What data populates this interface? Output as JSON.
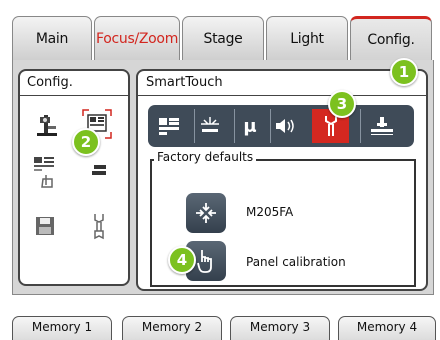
{
  "tabs": [
    {
      "label": "Main",
      "active": false,
      "color": "#111111"
    },
    {
      "label": "Focus/Zoom",
      "active": false,
      "color": "#d2261f"
    },
    {
      "label": "Stage",
      "active": false,
      "color": "#111111"
    },
    {
      "label": "Light",
      "active": false,
      "color": "#111111"
    },
    {
      "label": "Config.",
      "active": true,
      "color": "#111111"
    }
  ],
  "left_panel": {
    "title": "Config.",
    "icons": [
      "microscope-config-icon",
      "screen-select-icon",
      "touch-keypad-icon",
      "stack-icon",
      "save-disk-icon",
      "wrench-icon"
    ]
  },
  "right_panel": {
    "title": "SmartTouch",
    "toolbar": [
      "layout-icon",
      "light-icon",
      "mu-icon",
      "sound-icon",
      "wrench-icon",
      "stage-icon"
    ],
    "toolbar_mu": "μ",
    "active_toolbar_index": 4,
    "group_label": "Factory defaults",
    "actions": [
      {
        "label": "M205FA",
        "icon": "reset-arrows-icon"
      },
      {
        "label": "Panel calibration",
        "icon": "hand-pointer-icon"
      }
    ]
  },
  "memory_tabs": [
    "Memory 1",
    "Memory 2",
    "Memory 3",
    "Memory 4"
  ],
  "callouts": [
    "1",
    "2",
    "3",
    "4"
  ],
  "colors": {
    "accent": "#d2261f",
    "callout": "#7cc11f",
    "toolbar": "#3f4b58"
  }
}
